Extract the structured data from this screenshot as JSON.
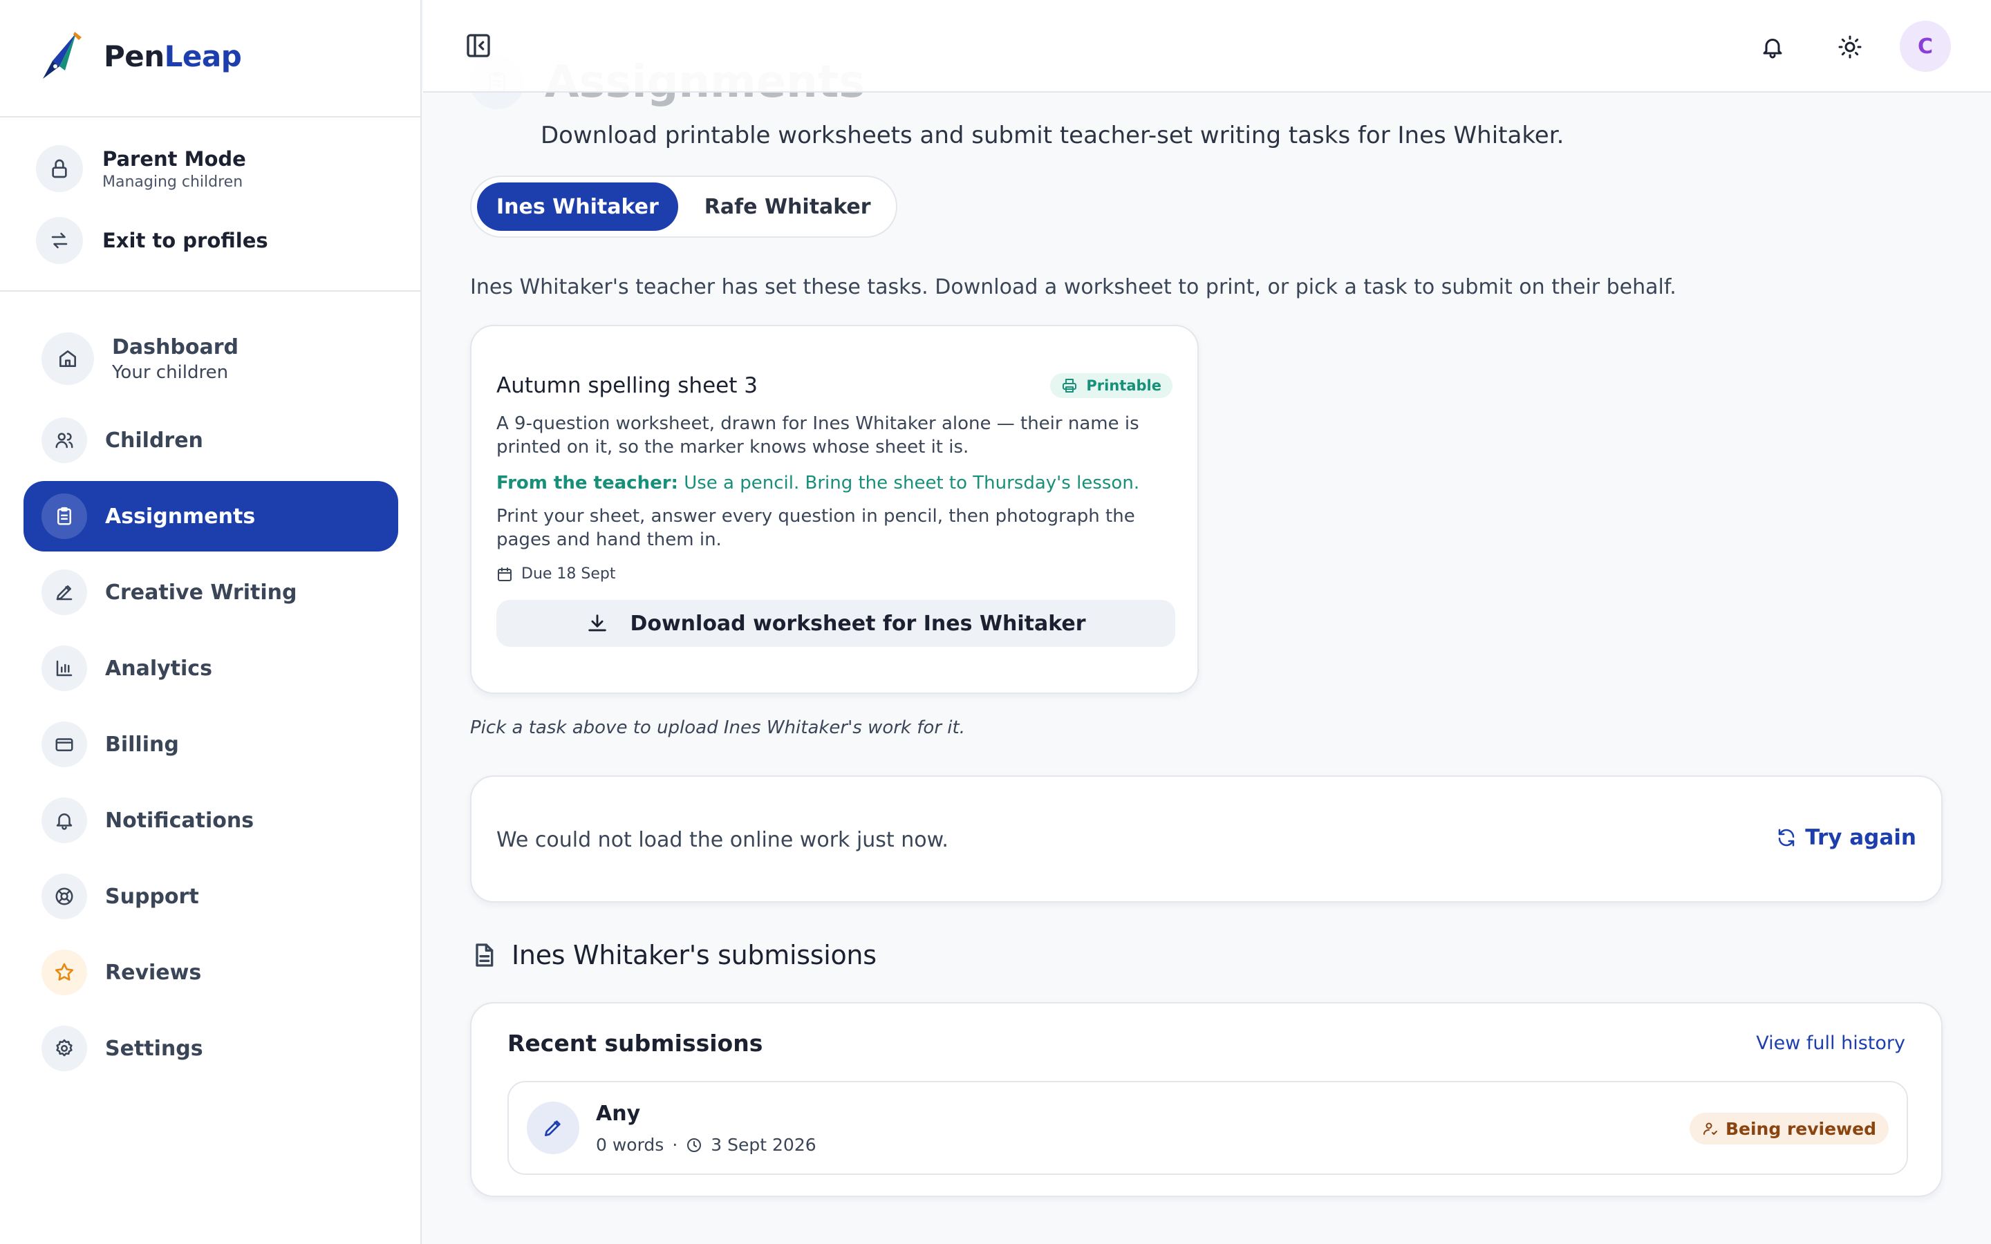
{
  "brand": {
    "name_part1": "Pen",
    "name_part2": "Leap"
  },
  "mode": {
    "title": "Parent Mode",
    "subtitle": "Managing children",
    "exit_label": "Exit to profiles"
  },
  "nav": {
    "dashboard": {
      "label": "Dashboard",
      "sub": "Your children"
    },
    "children": "Children",
    "assignments": "Assignments",
    "creative_writing": "Creative Writing",
    "analytics": "Analytics",
    "billing": "Billing",
    "notifications": "Notifications",
    "support": "Support",
    "reviews": "Reviews",
    "settings": "Settings"
  },
  "topbar": {
    "avatar_initial": "C"
  },
  "page": {
    "title": "Assignments",
    "subtitle": "Download printable worksheets and submit teacher-set writing tasks for Ines Whitaker."
  },
  "child_tabs": [
    "Ines Whitaker",
    "Rafe Whitaker"
  ],
  "intro": "Ines Whitaker's teacher has set these tasks. Download a worksheet to print, or pick a task to submit on their behalf.",
  "task": {
    "title": "Autumn spelling sheet 3",
    "badge": "Printable",
    "description": "A 9-question worksheet, drawn for Ines Whitaker alone — their name is printed on it, so the marker knows whose sheet it is.",
    "teacher_prefix": "From the teacher:",
    "teacher_note": "Use a pencil. Bring the sheet to Thursday's lesson.",
    "instructions": "Print your sheet, answer every question in pencil, then photograph the pages and hand them in.",
    "due": "Due 18 Sept",
    "download_label": "Download worksheet for Ines Whitaker"
  },
  "pick_hint": "Pick a task above to upload Ines Whitaker's work for it.",
  "error": {
    "message": "We could not load the online work just now.",
    "retry_label": "Try again"
  },
  "submissions": {
    "heading": "Ines Whitaker's submissions",
    "card_title": "Recent submissions",
    "view_history": "View full history",
    "items": [
      {
        "name": "Any",
        "words": "0 words",
        "separator": "·",
        "date": "3 Sept 2026",
        "status": "Being reviewed"
      }
    ]
  },
  "colors": {
    "primary": "#1d3fae",
    "teal": "#17907a",
    "review_badge_bg": "#fbeee3",
    "review_badge_text": "#8a4410"
  }
}
